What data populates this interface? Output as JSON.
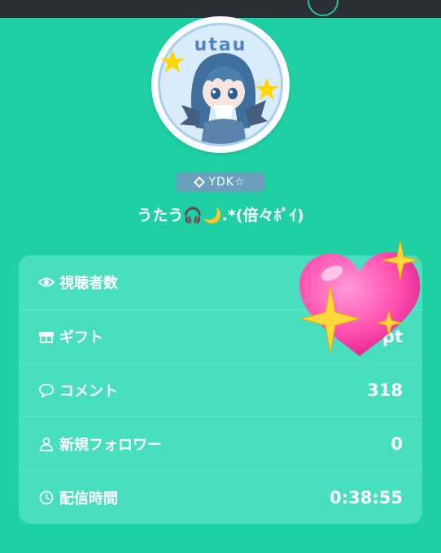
{
  "profile": {
    "avatar_text": "utau",
    "badge": "YDK☆",
    "username": "うたう🎧🌙.*(倍々ﾎﾟｲ)"
  },
  "stats": [
    {
      "icon": "eye-icon",
      "label": "視聴者数",
      "value": ""
    },
    {
      "icon": "gift-icon",
      "label": "ギフト",
      "value": "pt"
    },
    {
      "icon": "comment-icon",
      "label": "コメント",
      "value": "318"
    },
    {
      "icon": "person-icon",
      "label": "新規フォロワー",
      "value": "0"
    },
    {
      "icon": "clock-icon",
      "label": "配信時間",
      "value": "0:38:55"
    }
  ],
  "colors": {
    "background": "#1fd0a5",
    "card": "#47dfbd",
    "badge": "#6b9fbe",
    "heart": "#ff5fb9"
  }
}
